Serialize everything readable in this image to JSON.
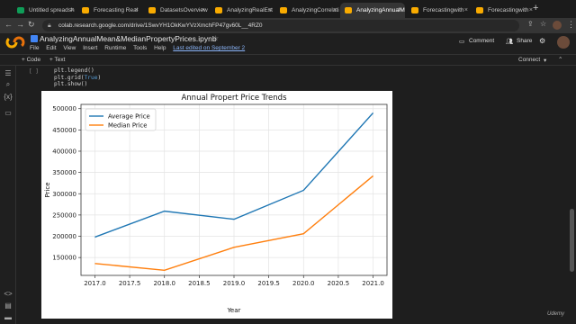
{
  "browser": {
    "tabs": [
      {
        "label": "Untitled spreadsh",
        "color": "#0f9d58"
      },
      {
        "label": "Forecasting Real",
        "color": "#f9ab00"
      },
      {
        "label": "DatasetsOverview",
        "color": "#f9ab00"
      },
      {
        "label": "AnalyzingRealEst",
        "color": "#f9ab00"
      },
      {
        "label": "AnalyzingCorrelati",
        "color": "#f9ab00"
      },
      {
        "label": "AnalyzingAnnualM",
        "color": "#f9ab00"
      },
      {
        "label": "Forecastingwith",
        "color": "#f9ab00"
      },
      {
        "label": "Forecastingwith",
        "color": "#f9ab00"
      }
    ],
    "new_tab": "+",
    "url": "colab.research.google.com/drive/1SwvYH1OkKwYVzXmchFP47gv60L__4RZ0"
  },
  "colab": {
    "title": "AnalyzingAnnualMean&MedianPropertyPrices.ipynb",
    "menus": [
      "File",
      "Edit",
      "View",
      "Insert",
      "Runtime",
      "Tools",
      "Help"
    ],
    "last_edited": "Last edited on September 2",
    "comment": "Comment",
    "share": "Share",
    "add_code": "+ Code",
    "add_text": "+ Text",
    "connect": "Connect",
    "cell_bracket": "[ ]",
    "code_lines": [
      "plt.legend()",
      "plt.grid(",
      "True",
      ")",
      "plt.show()"
    ],
    "watermark": "Udemy",
    "accent": "#f9ab00"
  },
  "chart_data": {
    "type": "line",
    "title": "Annual Propert Price Trends",
    "xlabel": "Year",
    "ylabel": "Price",
    "x": [
      2017,
      2018,
      2019,
      2020,
      2021
    ],
    "xlim": [
      2016.8,
      2021.2
    ],
    "ylim": [
      108000,
      510000
    ],
    "xticks": [
      "2017.0",
      "2017.5",
      "2018.0",
      "2018.5",
      "2019.0",
      "2019.5",
      "2020.0",
      "2020.5",
      "2021.0"
    ],
    "yticks": [
      "150000",
      "200000",
      "250000",
      "300000",
      "350000",
      "400000",
      "450000",
      "500000"
    ],
    "grid": true,
    "legend": "top-left",
    "series": [
      {
        "name": "Average Price",
        "color": "#1f77b4",
        "values": [
          198000,
          259000,
          240000,
          308000,
          490000
        ]
      },
      {
        "name": "Median Price",
        "color": "#ff7f0e",
        "values": [
          136000,
          120000,
          174000,
          206000,
          342000
        ]
      }
    ]
  }
}
